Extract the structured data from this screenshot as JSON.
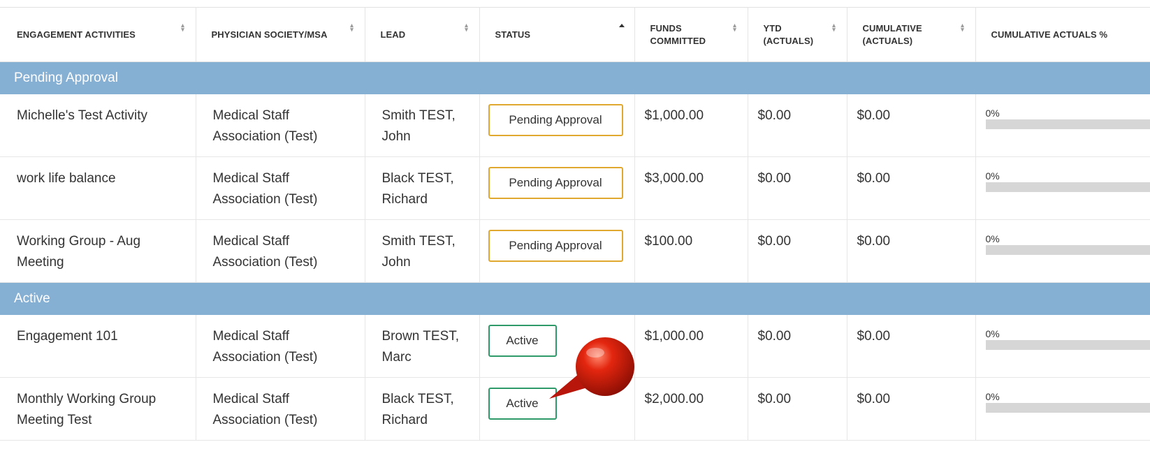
{
  "columns": [
    {
      "label": "ENGAGEMENT ACTIVITIES",
      "sort": "both"
    },
    {
      "label": "PHYSICIAN SOCIETY/MSA",
      "sort": "both"
    },
    {
      "label": "LEAD",
      "sort": "both"
    },
    {
      "label": "STATUS",
      "sort": "asc"
    },
    {
      "label": "FUNDS COMMITTED",
      "sort": "both"
    },
    {
      "label": "YTD (ACTUALS)",
      "sort": "both"
    },
    {
      "label": "CUMULATIVE (ACTUALS)",
      "sort": "both"
    },
    {
      "label": "CUMULATIVE ACTUALS %",
      "sort": "both"
    }
  ],
  "groups": [
    {
      "title": "Pending Approval",
      "rows": [
        {
          "activity": "Michelle's Test Activity",
          "society": "Medical Staff Association (Test)",
          "lead": "Smith TEST, John",
          "status": "Pending Approval",
          "funds": "$1,000.00",
          "ytd": "$0.00",
          "cumulative": "$0.00",
          "pct": "0%"
        },
        {
          "activity": "work life balance",
          "society": "Medical Staff Association (Test)",
          "lead": "Black TEST, Richard",
          "status": "Pending Approval",
          "funds": "$3,000.00",
          "ytd": "$0.00",
          "cumulative": "$0.00",
          "pct": "0%"
        },
        {
          "activity": "Working Group - Aug Meeting",
          "society": "Medical Staff Association (Test)",
          "lead": "Smith TEST, John",
          "status": "Pending Approval",
          "funds": "$100.00",
          "ytd": "$0.00",
          "cumulative": "$0.00",
          "pct": "0%"
        }
      ]
    },
    {
      "title": "Active",
      "rows": [
        {
          "activity": "Engagement 101",
          "society": "Medical Staff Association (Test)",
          "lead": "Brown TEST, Marc",
          "status": "Active",
          "funds": "$1,000.00",
          "ytd": "$0.00",
          "cumulative": "$0.00",
          "pct": "0%"
        },
        {
          "activity": "Monthly Working Group Meeting Test",
          "society": "Medical Staff Association (Test)",
          "lead": "Black TEST, Richard",
          "status": "Active",
          "funds": "$2,000.00",
          "ytd": "$0.00",
          "cumulative": "$0.00",
          "pct": "0%"
        }
      ]
    }
  ],
  "colors": {
    "group_header_bg": "#86afd4",
    "pending_border": "#e0a82e",
    "active_border": "#2e9a6a",
    "pointer_pin": "#cc1a0a"
  },
  "icons": {
    "sort": "sort-updown-icon",
    "sort_asc": "sort-asc-icon",
    "pointer": "map-pin-pointer-icon"
  }
}
